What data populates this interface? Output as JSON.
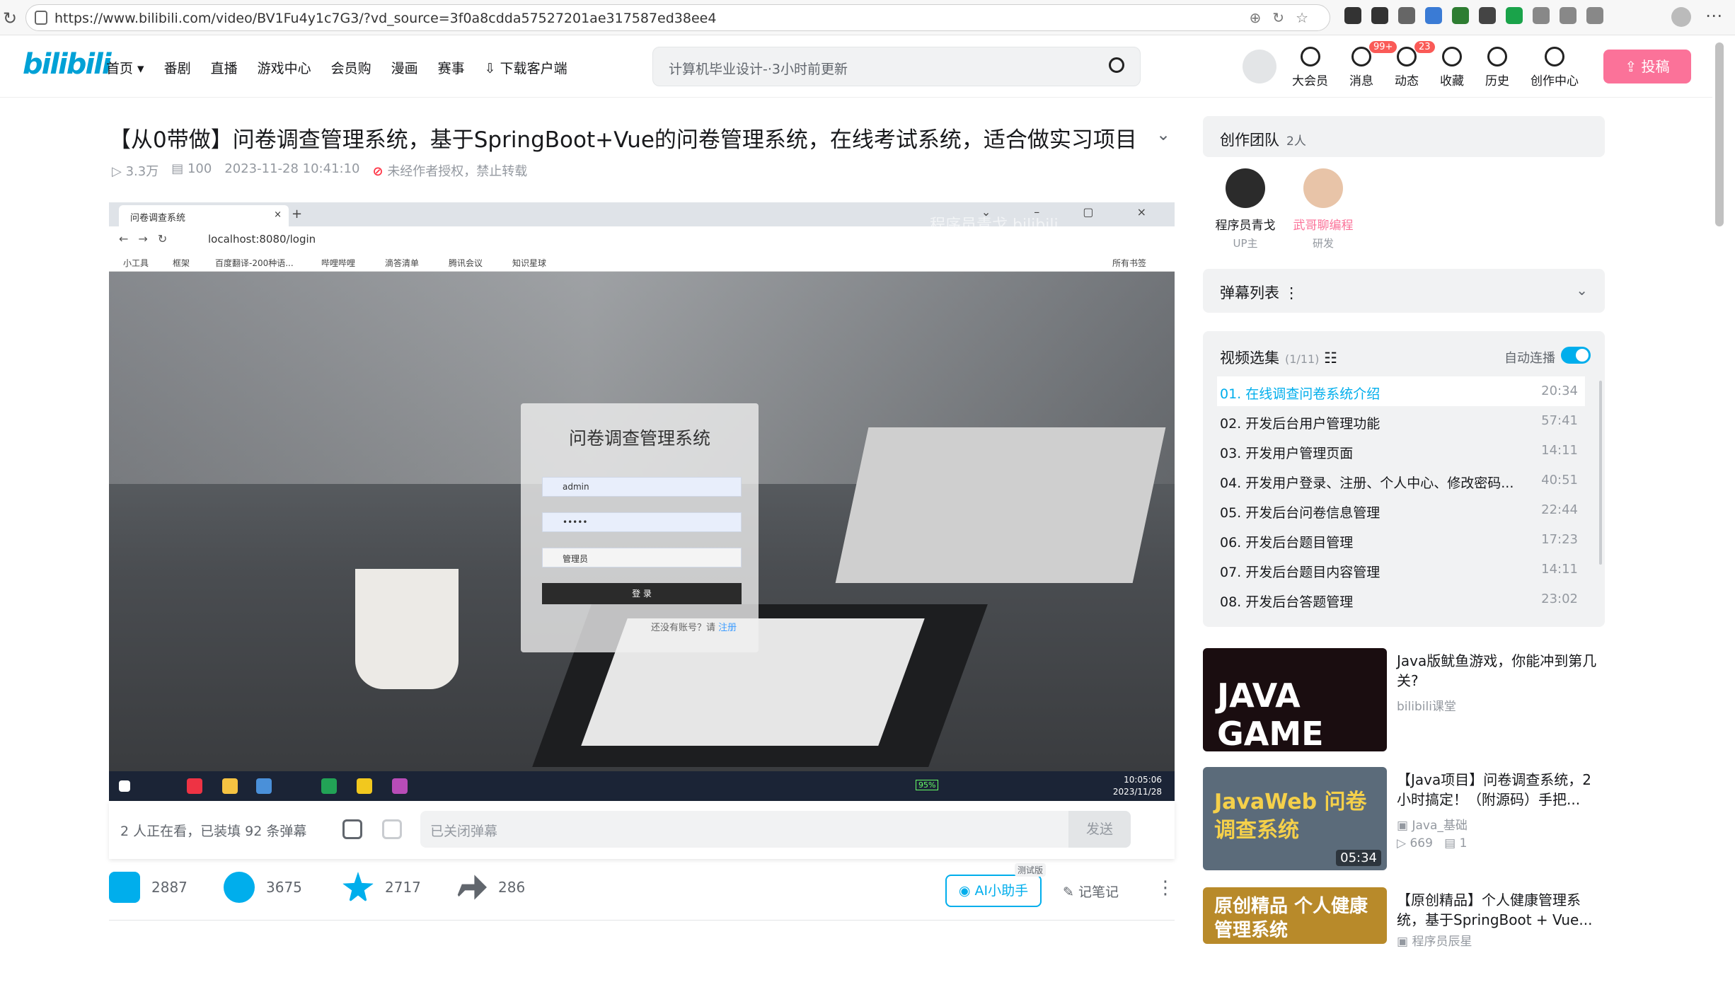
{
  "browser": {
    "url": "https://www.bilibili.com/video/BV1Fu4y1c7G3/?vd_source=3f0a8cdda57527201ae317587ed38ee4"
  },
  "header": {
    "logo": "bilibili",
    "nav": [
      "首页 ▾",
      "番剧",
      "直播",
      "游戏中心",
      "会员购",
      "漫画",
      "赛事",
      "⇩ 下载客户端"
    ],
    "search_placeholder": "计算机毕业设计-·3小时前更新",
    "right_nav": [
      {
        "label": "大会员",
        "badge": ""
      },
      {
        "label": "消息",
        "badge": "99+"
      },
      {
        "label": "动态",
        "badge": "23"
      },
      {
        "label": "收藏",
        "badge": ""
      },
      {
        "label": "历史",
        "badge": ""
      },
      {
        "label": "创作中心",
        "badge": ""
      }
    ],
    "upload": "⇪ 投稿"
  },
  "video": {
    "title": "【从0带做】问卷调查管理系统，基于SpringBoot+Vue的问卷管理系统，在线考试系统，适合做实习项目、…",
    "views": "3.3万",
    "danmaku": "100",
    "date": "2023-11-28 10:41:10",
    "notice": "未经作者授权，禁止转载"
  },
  "player": {
    "tab": "问卷调查系统",
    "address": "localhost:8080/login",
    "bookmarks": [
      "小工具",
      "框架",
      "百度翻译-200种语...",
      "哔哩哔哩",
      "滴答清单",
      "腾讯会议",
      "知识星球",
      "所有书签"
    ],
    "watermark": "程序员青戈 bilibili",
    "login_title": "问卷调查管理系统",
    "username": "admin",
    "password": "•••••",
    "role": "管理员",
    "login_btn": "登 录",
    "register_prompt": "还没有账号？请",
    "register_link": "注册",
    "clock_time": "10:05:06",
    "clock_date": "2023/11/28",
    "battery": "95%"
  },
  "danmaku_bar": {
    "watching": "2 人正在看，已装填 92 条弹幕",
    "placeholder": "已关闭弹幕",
    "send": "发送"
  },
  "actions": {
    "like": "2887",
    "coin": "3675",
    "fav": "2717",
    "share": "286",
    "ai": "AI小助手",
    "ai_tag": "测试版",
    "note": "记笔记"
  },
  "sidebar": {
    "team_title": "创作团队",
    "team_count": "2人",
    "members": [
      {
        "name": "程序员青戈",
        "role": "UP主",
        "color": "#18191c"
      },
      {
        "name": "武哥聊编程",
        "role": "研发",
        "color": "#fb7299"
      }
    ],
    "danmaku_list": "弹幕列表 ⋮",
    "playlist_title": "视频选集",
    "playlist_count": "(1/11)",
    "autoplay": "自动连播",
    "episodes": [
      {
        "t": "01. 在线调查问卷系统介绍",
        "d": "20:34"
      },
      {
        "t": "02. 开发后台用户管理功能",
        "d": "57:41"
      },
      {
        "t": "03. 开发用户管理页面",
        "d": "14:11"
      },
      {
        "t": "04. 开发用户登录、注册、个人中心、修改密码...",
        "d": "40:51"
      },
      {
        "t": "05. 开发后台问卷信息管理",
        "d": "22:44"
      },
      {
        "t": "06. 开发后台题目管理",
        "d": "17:23"
      },
      {
        "t": "07. 开发后台题目内容管理",
        "d": "14:11"
      },
      {
        "t": "08. 开发后台答题管理",
        "d": "23:02"
      }
    ],
    "recs": [
      {
        "title": "Java版鱿鱼游戏，你能冲到第几关?",
        "up": "bilibili课堂",
        "views": "",
        "dm": "",
        "dur": "",
        "thumb": "JAVA GAME"
      },
      {
        "title": "【Java项目】问卷调查系统，2小时搞定！（附源码）手把...",
        "up": "Java_基础",
        "views": "669",
        "dm": "1",
        "dur": "05:34",
        "thumb": "JavaWeb 问卷调查系统"
      },
      {
        "title": "【原创精品】个人健康管理系统，基于SpringBoot + Vue...",
        "up": "程序员辰星",
        "views": "",
        "dm": "",
        "dur": "",
        "thumb": "原创精品 个人健康管理系统"
      }
    ]
  },
  "colors": {
    "brand_blue": "#00aeec",
    "brand_pink": "#fb7299"
  }
}
